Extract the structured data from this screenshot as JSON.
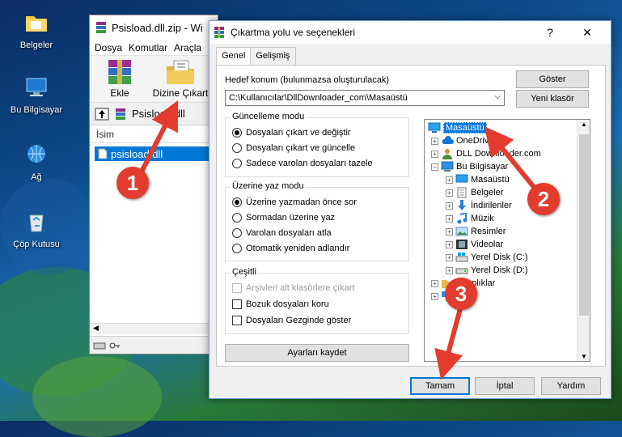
{
  "desktop": {
    "icons": [
      {
        "label": "Belgeler"
      },
      {
        "label": "Bu Bilgisayar"
      },
      {
        "label": "Ağ"
      },
      {
        "label": "Çöp Kutusu"
      }
    ]
  },
  "bg_window": {
    "title": "Psisload.dll.zip - Wi",
    "menu": [
      "Dosya",
      "Komutlar",
      "Araçla"
    ],
    "toolbar": {
      "add_label": "Ekle",
      "extract_label": "Dizine Çıkart"
    },
    "path": "Psisload.dll",
    "column_name": "İsim",
    "file_name": "psisload.dll"
  },
  "dialog": {
    "title": "Çıkartma yolu ve seçenekleri",
    "help_label": "?",
    "close_label": "✕",
    "tabs": [
      {
        "label": "Genel"
      },
      {
        "label": "Gelişmiş"
      }
    ],
    "dest_label": "Hedef konum (bulunmazsa oluşturulacak)",
    "dest_value": "C:\\Kullanıcılar\\DllDownloader_com\\Masaüstü",
    "show_button": "Göster",
    "new_folder_button": "Yeni klasör",
    "update_group": {
      "title": "Güncelleme modu",
      "options": [
        "Dosyaları çıkart ve değiştir",
        "Dosyaları çıkart ve güncelle",
        "Sadece varolan dosyaları tazele"
      ],
      "selected_index": 0
    },
    "overwrite_group": {
      "title": "Üzerine yaz modu",
      "options": [
        "Üzerine yazmadan önce sor",
        "Sormadan üzerine yaz",
        "Varolan dosyaları atla",
        "Otomatik yeniden adlandır"
      ],
      "selected_index": 0
    },
    "misc_group": {
      "title": "Çeşitli",
      "options": [
        "Arşivleri alt klasörlere çıkart",
        "Bozuk dosyaları koru",
        "Dosyaları Gezginde göster"
      ]
    },
    "save_settings_button": "Ayarları kaydet",
    "tree": {
      "items": [
        {
          "label": "Masaüstü",
          "selected": true
        },
        {
          "label": "OneDrive"
        },
        {
          "label": "DLL Downloader.com"
        },
        {
          "label": "Bu Bilgisayar"
        },
        {
          "label": "Masaüstü"
        },
        {
          "label": "Belgeler"
        },
        {
          "label": "İndirilenler"
        },
        {
          "label": "Müzik"
        },
        {
          "label": "Resimler"
        },
        {
          "label": "Videolar"
        },
        {
          "label": "Yerel Disk (C:)"
        },
        {
          "label": "Yerel Disk (D:)"
        },
        {
          "label": "Kitaplıklar"
        },
        {
          "label": ""
        }
      ]
    },
    "ok_button": "Tamam",
    "cancel_button": "İptal",
    "help_button": "Yardım"
  },
  "annotations": {
    "step1": "1",
    "step2": "2",
    "step3": "3",
    "arrow_color": "#e33b2e"
  }
}
